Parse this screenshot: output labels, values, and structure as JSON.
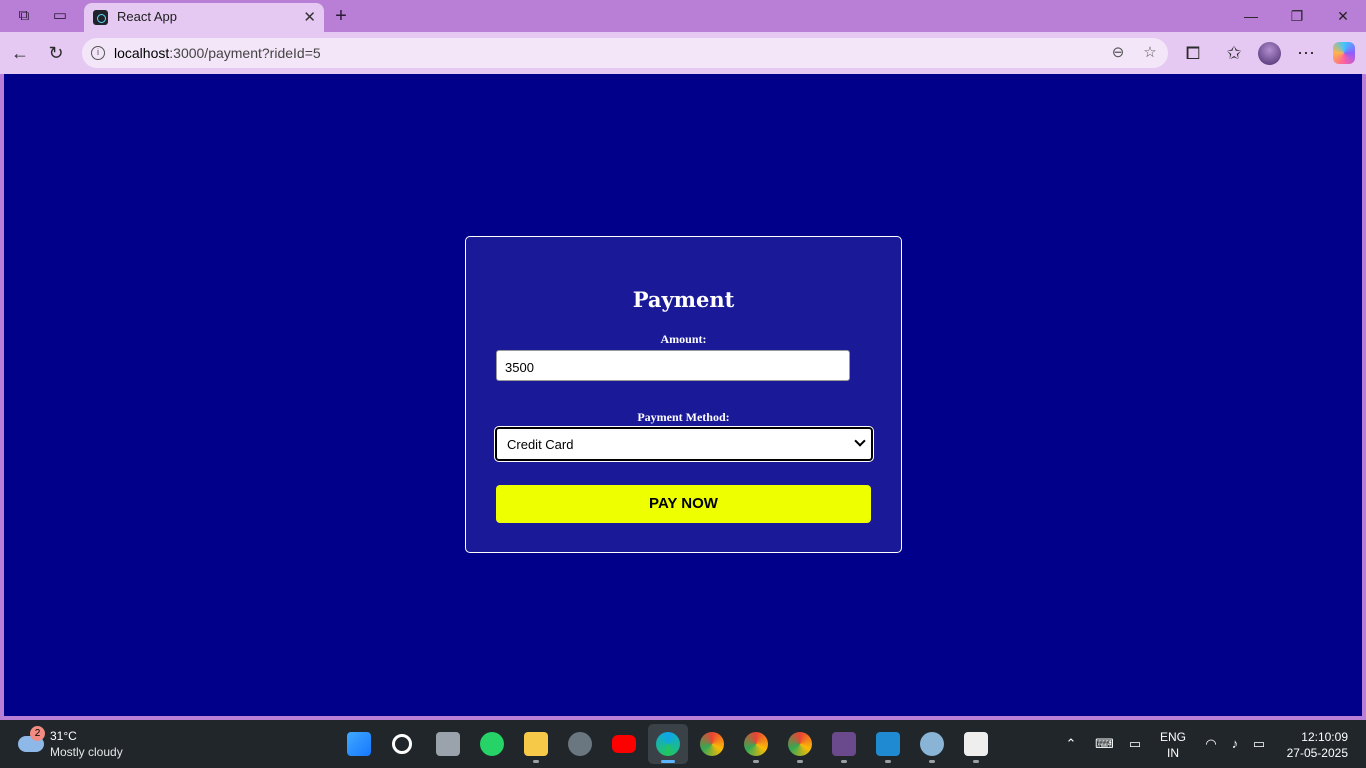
{
  "browser": {
    "tab_title": "React App",
    "tab_close": "✕",
    "new_tab": "+",
    "url_host": "localhost",
    "url_rest": ":3000/payment?rideId=5",
    "window_controls": {
      "minimize": "—",
      "maximize": "❐",
      "close": "✕"
    }
  },
  "payment": {
    "title": "Payment",
    "amount_label": "Amount:",
    "amount_value": "3500",
    "method_label": "Payment Method:",
    "method_selected": "Credit Card",
    "pay_button": "PAY NOW"
  },
  "taskbar": {
    "weather_badge": "2",
    "weather_temp": "31°C",
    "weather_desc": "Mostly cloudy",
    "lang_top": "ENG",
    "lang_bottom": "IN",
    "time": "12:10:09",
    "date": "27-05-2025"
  },
  "colors": {
    "page_bg": "#00008b",
    "card_bg": "#1a1a99",
    "pay_button_bg": "#eeff00",
    "browser_frame": "#b97fd6"
  }
}
